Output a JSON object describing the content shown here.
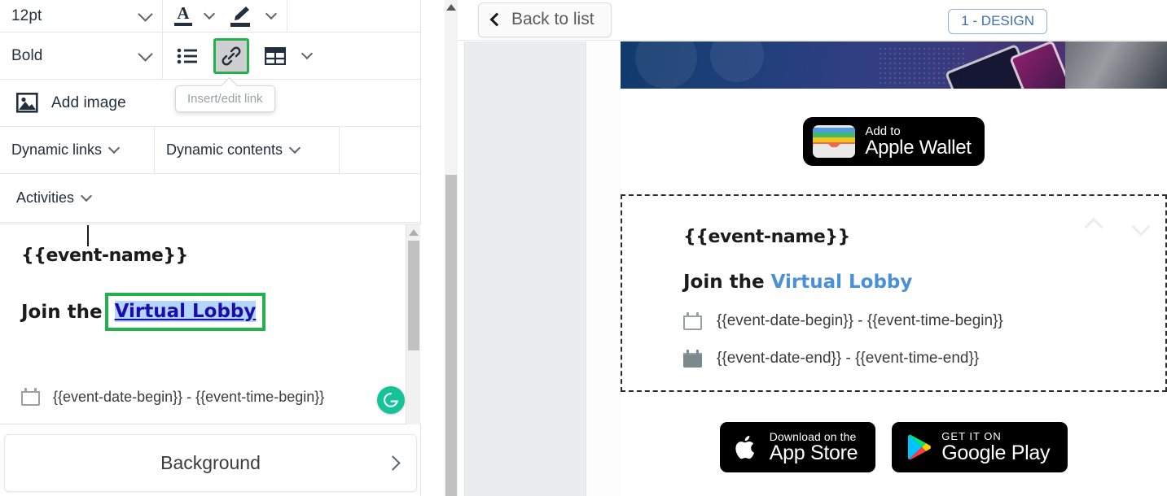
{
  "editor": {
    "toolbar": {
      "font_size": "12pt",
      "font_size_icon": "chevron-down-icon",
      "text_color_icon": "text-color-icon",
      "text_color_chevron": "chevron-down-icon",
      "highlight_icon": "highlight-color-icon",
      "highlight_chevron": "chevron-down-icon",
      "format_style": "Bold",
      "format_chevron": "chevron-down-icon",
      "bullet_list_icon": "bullet-list-icon",
      "link_icon": "insert-link-icon",
      "table_icon": "insert-table-icon",
      "table_chevron": "chevron-down-icon",
      "add_image_icon": "add-image-icon",
      "add_image_label": "Add image",
      "dynamic_links_label": "Dynamic links",
      "dynamic_contents_label": "Dynamic contents",
      "activities_label": "Activities"
    },
    "tooltip": {
      "text": "Insert/edit link"
    },
    "content": {
      "event_name": "{{event-name}}",
      "join_prefix": "Join the",
      "link_text": "Virtual Lobby",
      "calendar_icon": "calendar-icon",
      "date_line": "{{event-date-begin}} - {{event-time-begin}}"
    },
    "grammarly_icon": "grammarly-icon",
    "scrollbar": {
      "up_arrow_icon": "scroll-up-arrow-icon"
    },
    "background_row": {
      "label": "Background",
      "chevron_icon": "chevron-right-icon"
    },
    "colors": {
      "selection_highlight": "#b4d5fe",
      "link_text": "#1a0dab",
      "active_outline": "#22b14c",
      "grammarly_green": "#15c39a"
    }
  },
  "outer_scrollbar": {
    "up_arrow_icon": "scroll-up-arrow-icon"
  },
  "preview": {
    "header": {
      "back_button": {
        "label": "Back to list",
        "icon": "chevron-left-icon"
      },
      "design_tab": "1 - DESIGN"
    },
    "banner": {
      "icon": "event-banner-image"
    },
    "wallet_badge": {
      "icon": "apple-wallet-icon",
      "line1": "Add to",
      "line2": "Apple Wallet"
    },
    "block": {
      "event_name": "{{event-name}}",
      "join_prefix": "Join the ",
      "link_text": "Virtual Lobby",
      "rows": [
        {
          "icon": "calendar-outline-icon",
          "text": "{{event-date-begin}} - {{event-time-begin}}"
        },
        {
          "icon": "calendar-filled-icon",
          "text": "{{event-date-end}} - {{event-time-end}}"
        }
      ],
      "move_up_icon": "chevron-up-icon",
      "move_down_icon": "chevron-down-icon"
    },
    "stores": [
      {
        "icon": "apple-logo-icon",
        "line1": "Download on the",
        "line2": "App Store"
      },
      {
        "icon": "google-play-icon",
        "line1": "GET IT ON",
        "line2": "Google Play"
      }
    ],
    "colors": {
      "design_tab_border": "#8fb4e3",
      "design_tab_text": "#3f6fad",
      "preview_link": "#4a90d9"
    }
  }
}
